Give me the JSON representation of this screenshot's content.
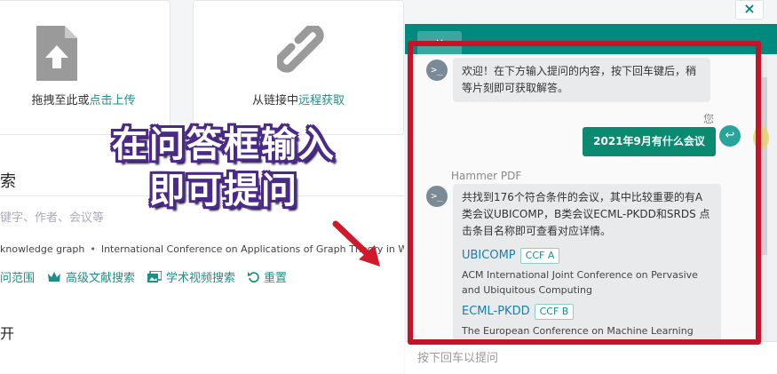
{
  "upload": {
    "drag_text": "拖拽至此或",
    "drag_link": "点击上传",
    "link_text": "从链接中",
    "link_link": "远程获取"
  },
  "search": {
    "section_title": "索",
    "placeholder": "键字、作者、会议等",
    "crumbs": [
      "knowledge graph",
      "International Conference on Applications of Graph Theory in Wireless Ad"
    ],
    "actions": [
      "问范围",
      "高级文献搜索",
      "学术视频搜索",
      "重置"
    ],
    "extra_label": "开"
  },
  "overlay": {
    "line1": "在问答框输入",
    "line2": "即可提问"
  },
  "chat": {
    "close": "×",
    "tab_label": "×",
    "welcome": "欢迎！在下方输入提问的内容，按下回车键后，稍等片刻即可获取解答。",
    "me_label": "您",
    "user_question": "2021年9月有什么会议",
    "sender": "Hammer PDF",
    "answer_intro": "共找到176个符合条件的会议，其中比较重要的有A类会议UBICOMP，B类会议ECML-PKDD和SRDS 点击条目名称即可查看对应详情。",
    "results": [
      {
        "name": "UBICOMP",
        "rank": "CCF A",
        "desc": "ACM International Joint Conference on Pervasive and Ubiquitous Computing"
      },
      {
        "name": "ECML-PKDD",
        "rank": "CCF B",
        "desc": "The European Conference on Machine Learning and"
      }
    ],
    "input_placeholder": "按下回车以提问"
  },
  "colors": {
    "accent": "#008a7e",
    "highlight_frame": "#c6132a"
  }
}
